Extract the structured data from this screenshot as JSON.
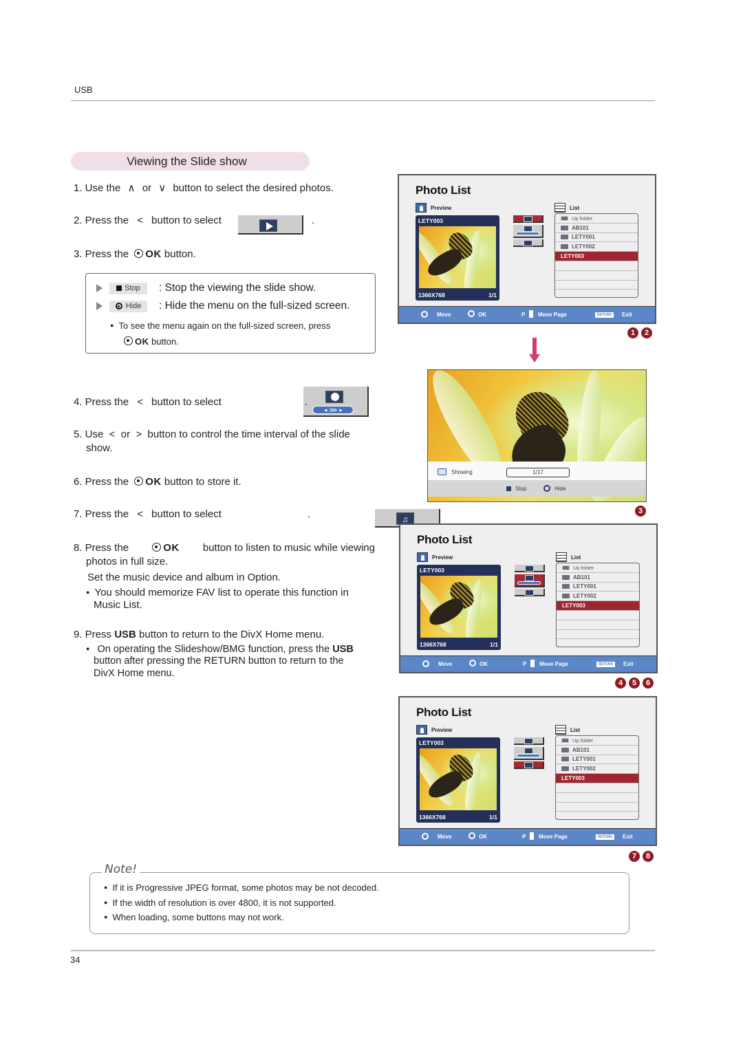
{
  "header": {
    "section": "USB"
  },
  "section_title": "Viewing the Slide show",
  "steps": {
    "s1": {
      "prefix": "1. Use the",
      "key1": "∧",
      "mid": "or",
      "key2": "∨",
      "suffix": "button to select the desired photos."
    },
    "s2": {
      "prefix": "2. Press the",
      "key": "<",
      "suffix": "button to select",
      "end": "."
    },
    "s3": {
      "prefix": "3. Press the",
      "ok": "OK",
      "suffix": "button."
    },
    "s4": {
      "prefix": "4. Press the",
      "key": "<",
      "suffix": "button to select",
      "end": "."
    },
    "s5": {
      "line1": "5. Use  <  or  >  button to control the time interval of the slide",
      "line2": "show."
    },
    "s6": {
      "prefix": "6. Press the",
      "ok": "OK",
      "suffix": "button to store it."
    },
    "s7": {
      "prefix": "7. Press the",
      "key": "<",
      "suffix": "button to select",
      "end": "."
    },
    "s8": {
      "prefix": "8. Press the",
      "ok": "OK",
      "suffix": "button to listen to music while viewing",
      "line2": "photos in full size.",
      "line3": "Set the music device and album in Option.",
      "bullet1": "You should memorize FAV list to operate this function in",
      "bullet2": "Music List."
    },
    "s9": {
      "prefix": "9. Press",
      "usb": "USB",
      "suffix": "button to return to the DivX Home menu.",
      "bullet_a": "On operating the Slideshow/BMG function, press the",
      "bullet_usb": "USB",
      "bullet_b": "button after pressing the RETURN button to return to the",
      "bullet_c": "DivX Home menu."
    }
  },
  "info_box": {
    "stop_chip": "Stop",
    "stop_desc": ": Stop the viewing the slide show.",
    "hide_chip": "Hide",
    "hide_desc": ": Hide the menu on the full-sized screen.",
    "note_line1": "To see the menu again on the full-sized screen, press",
    "note_ok": "OK",
    "note_line2": "button."
  },
  "photo_list": {
    "title": "Photo List",
    "preview_label": "Preview",
    "list_label": "List",
    "preview_name": "LETY003",
    "resolution": "1366X768",
    "count": "1/1",
    "items": [
      "Up folder",
      "AB101",
      "LETY001",
      "LETY002",
      "LETY003"
    ],
    "selected_item": "LETY003",
    "footer": {
      "move": "Move",
      "ok": "OK",
      "p": "P",
      "move_page": "Move Page",
      "return": "RETURN",
      "exit": "Exit"
    }
  },
  "screens": [
    {
      "badges": [
        "1",
        "2"
      ],
      "selected_button": "slideshow"
    },
    {
      "badges": [
        "4",
        "5",
        "6"
      ],
      "selected_button": "interval"
    },
    {
      "badges": [
        "7",
        "8"
      ],
      "selected_button": "music"
    }
  ],
  "fullscreen": {
    "showing_label": "Showing",
    "progress": "1/17",
    "stop": "Stop",
    "hide": "Hide",
    "badge": "3"
  },
  "note": {
    "title": "Note!",
    "items": [
      "If it is Progressive JPEG format, some photos may be not decoded.",
      "If the width of resolution is over 4800, it is not supported.",
      "When loading, some buttons may not work."
    ]
  },
  "page_number": "34",
  "colors": {
    "accent_red": "#9e2630",
    "footer_blue": "#5b86c8",
    "pill_pink": "#f0dfe9"
  }
}
